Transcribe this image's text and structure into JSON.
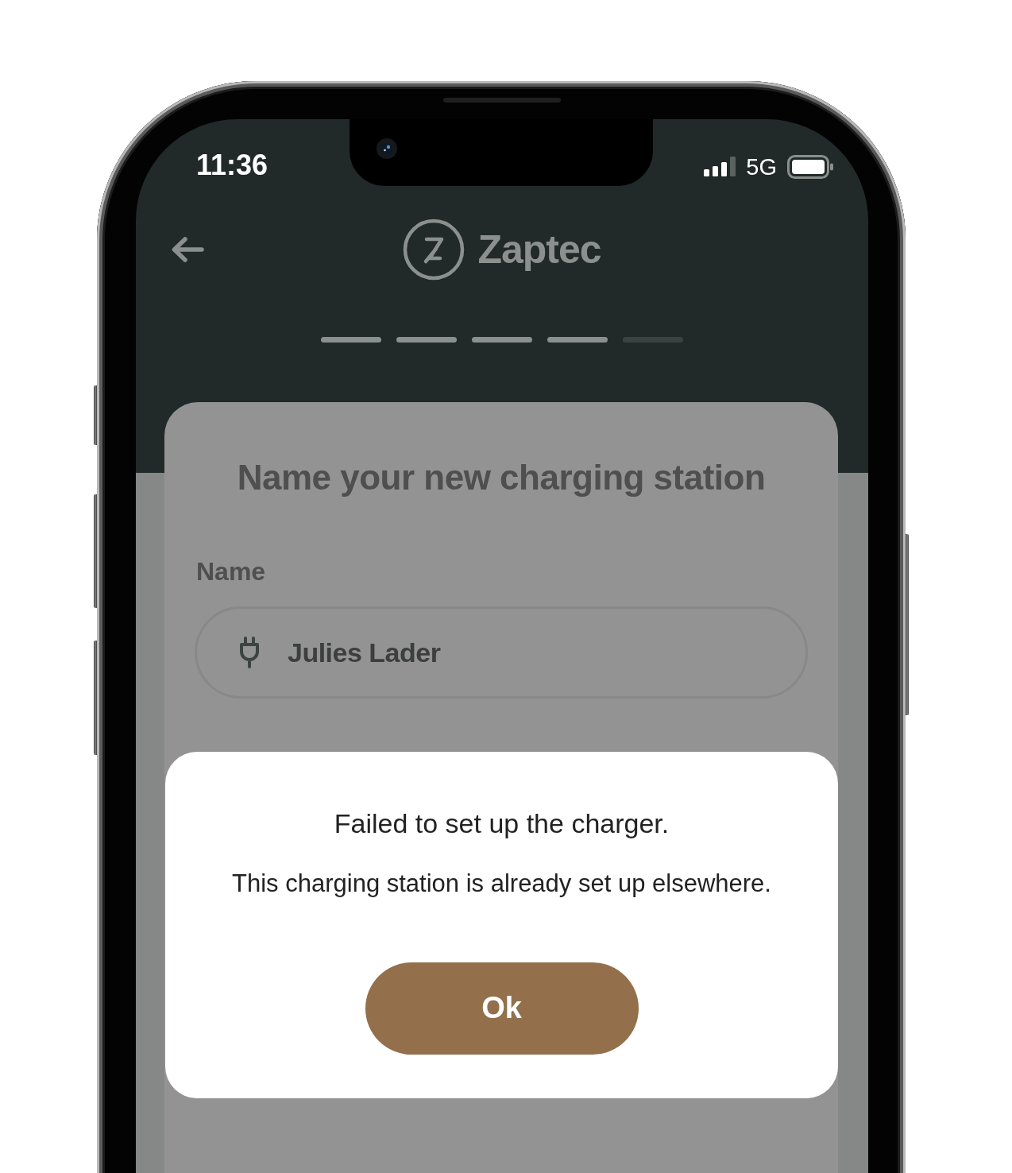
{
  "status_bar": {
    "time": "11:36",
    "network": "5G"
  },
  "header": {
    "brand": "Zaptec"
  },
  "steps": [
    {
      "done": true
    },
    {
      "done": true
    },
    {
      "done": true
    },
    {
      "done": true
    },
    {
      "done": false
    }
  ],
  "card": {
    "title": "Name your new charging station",
    "field": {
      "label": "Name",
      "value": "Julies Lader"
    }
  },
  "dialog": {
    "title": "Failed to set up the charger.",
    "message": "This charging station is already set up elsewhere.",
    "button": "Ok"
  }
}
